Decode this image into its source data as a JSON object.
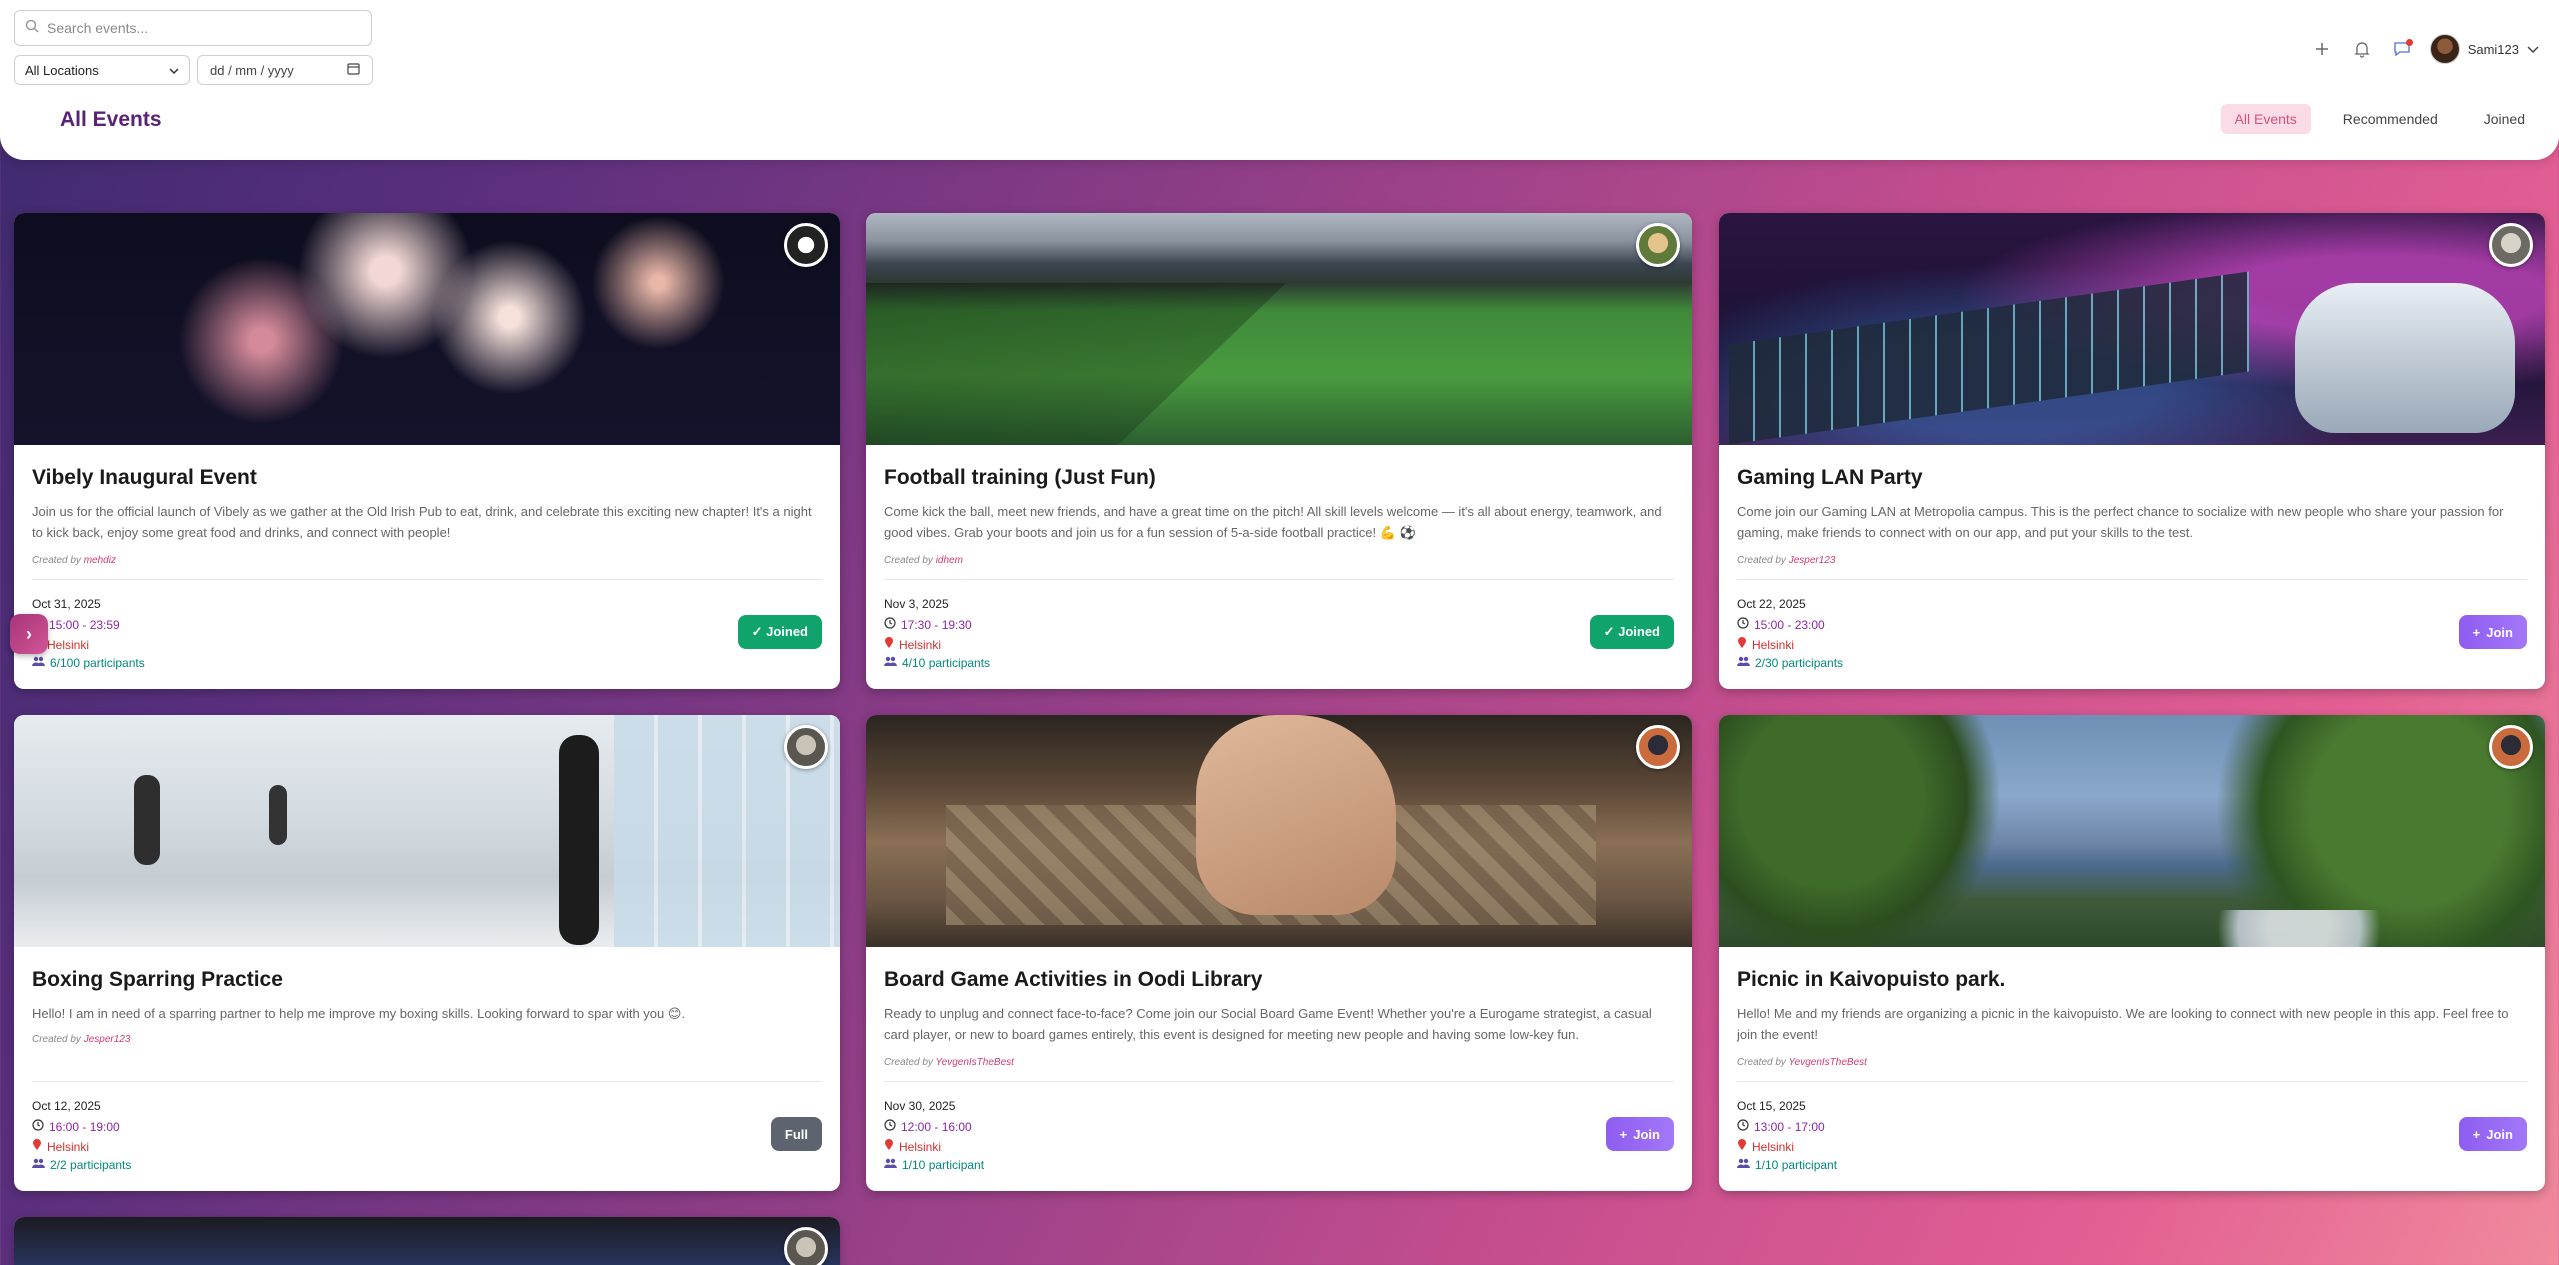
{
  "header": {
    "search_placeholder": "Search events...",
    "location_select": "All Locations",
    "date_placeholder": "dd / mm / yyyy",
    "page_title": "All Events",
    "username": "Sami123",
    "tabs": [
      {
        "label": "All Events",
        "active": true
      },
      {
        "label": "Recommended",
        "active": false
      },
      {
        "label": "Joined",
        "active": false
      }
    ]
  },
  "colors": {
    "accent": "#5a2276",
    "joined": "#10a36b",
    "join": "#8f5cf0",
    "full": "#5d6470"
  },
  "events": [
    {
      "title": "Vibely Inaugural Event",
      "description": "Join us for the official launch of Vibely as we gather at the Old Irish Pub to eat, drink, and celebrate this exciting new chapter! It's a night to kick back, enjoy some great food and drinks, and connect with people!",
      "created_by_label": "Created by",
      "creator": "mehdiz",
      "date": "Oct 31, 2025",
      "time": "15:00 - 23:59",
      "location": "Helsinki",
      "participants": "6/100 participants",
      "button": "✓ Joined",
      "image": "fireworks"
    },
    {
      "title": "Football training (Just Fun)",
      "description": "Come kick the ball, meet new friends, and have a great time on the pitch! All skill levels welcome — it's all about energy, teamwork, and good vibes. Grab your boots and join us for a fun session of 5-a-side football practice! 💪 ⚽",
      "created_by_label": "Created by",
      "creator": "idhem",
      "date": "Nov 3, 2025",
      "time": "17:30 - 19:30",
      "location": "Helsinki",
      "participants": "4/10 participants",
      "button": "✓ Joined",
      "image": "football-field"
    },
    {
      "title": "Gaming LAN Party",
      "description": "Come join our Gaming LAN at Metropolia campus. This is the perfect chance to socialize with new people who share your passion for gaming, make friends to connect with on our app, and put your skills to the test.",
      "created_by_label": "Created by",
      "creator": "Jesper123",
      "date": "Oct 22, 2025",
      "time": "15:00 - 23:00",
      "location": "Helsinki",
      "participants": "2/30 participants",
      "button": "Join",
      "image": "keyboard-controller"
    },
    {
      "title": "Boxing Sparring Practice",
      "description": "Hello! I am in need of a sparring partner to help me improve my boxing skills. Looking forward to spar with you 😊.",
      "created_by_label": "Created by",
      "creator": "Jesper123",
      "date": "Oct 12, 2025",
      "time": "16:00 - 19:00",
      "location": "Helsinki",
      "participants": "2/2 participants",
      "button": "Full",
      "image": "boxing-gym"
    },
    {
      "title": "Board Game Activities in Oodi Library",
      "description": "Ready to unplug and connect face-to-face? Come join our Social Board Game Event! Whether you're a Eurogame strategist, a casual card player, or new to board games entirely, this event is designed for meeting new people and having some low-key fun.",
      "created_by_label": "Created by",
      "creator": "YevgenIsTheBest",
      "date": "Nov 30, 2025",
      "time": "12:00 - 16:00",
      "location": "Helsinki",
      "participants": "1/10 participant",
      "button": "Join",
      "image": "board-game"
    },
    {
      "title": "Picnic in Kaivopuisto park.",
      "description": "Hello! Me and my friends are organizing a picnic in the kaivopuisto. We are looking to connect with new people in this app. Feel free to join the event!",
      "created_by_label": "Created by",
      "creator": "YevgenIsTheBest",
      "date": "Oct 15, 2025",
      "time": "13:00 - 17:00",
      "location": "Helsinki",
      "participants": "1/10 participant",
      "button": "Join",
      "image": "park-sea"
    }
  ]
}
